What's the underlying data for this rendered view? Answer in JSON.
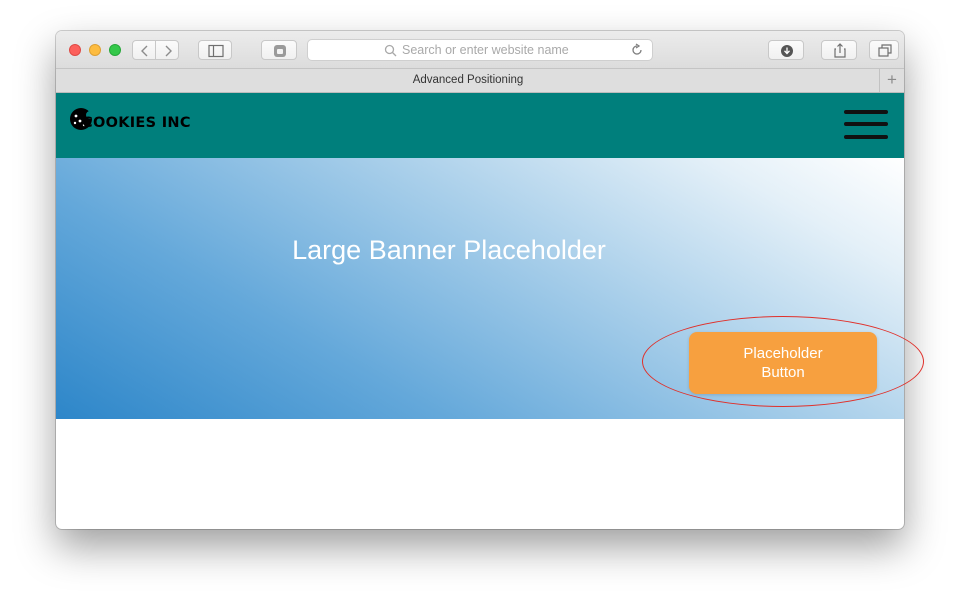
{
  "browser": {
    "url_placeholder": "Search or enter website name",
    "tab_title": "Advanced Positioning",
    "new_tab_label": "+"
  },
  "site": {
    "logo_text": "COOKIES INC",
    "banner_title": "Large Banner Placeholder",
    "cta_label": "Placeholder Button"
  },
  "colors": {
    "navbar": "#007f7c",
    "cta": "#f7a03f",
    "highlight": "#e0302a"
  }
}
